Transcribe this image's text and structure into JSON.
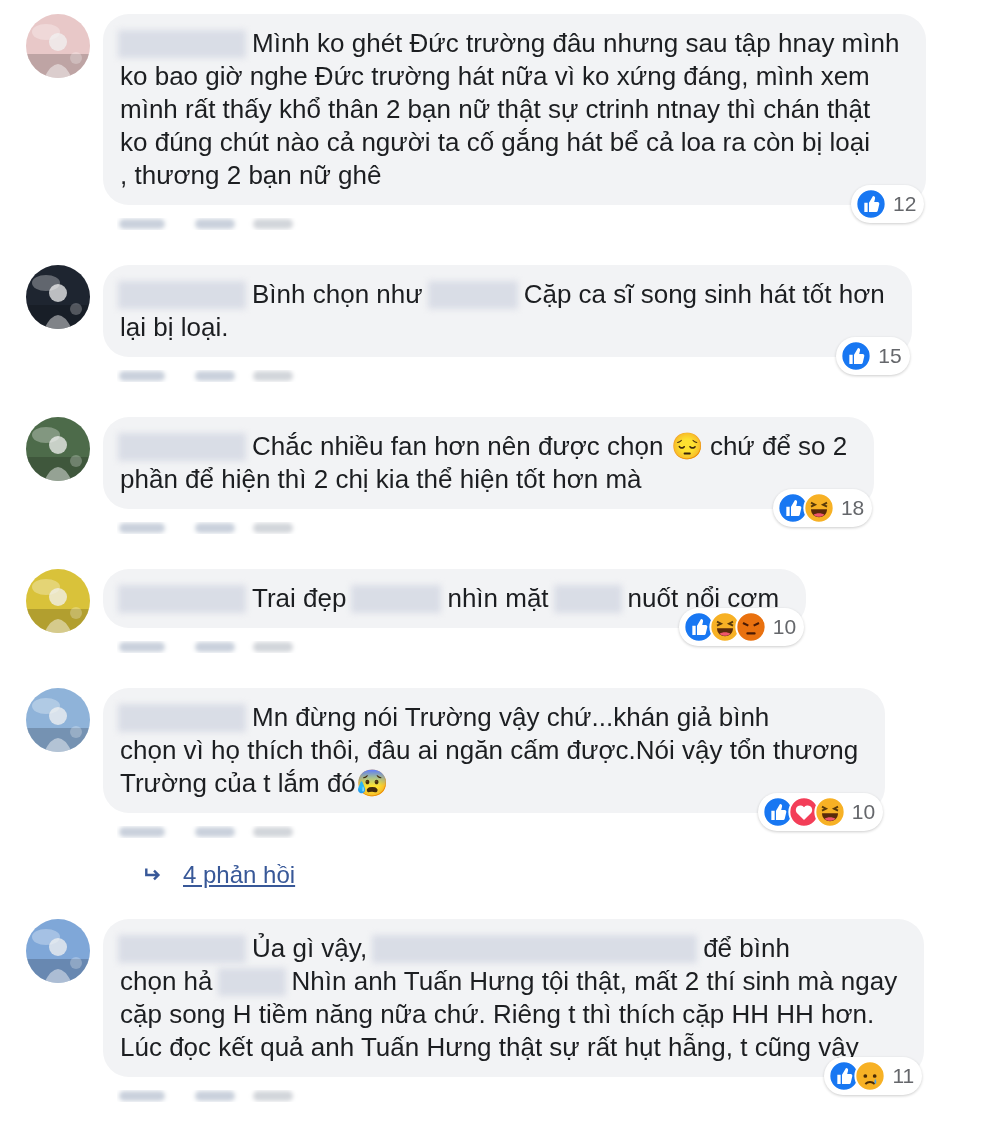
{
  "comments": [
    {
      "avatar": {
        "kind": "picture",
        "color": "#e8c8c8"
      },
      "lines": [
        [
          {
            "kind": "name"
          },
          {
            "kind": "text",
            "text": "Mình ko ghét Đức trường đâu nhưng sau tập hnay mình"
          }
        ],
        [
          {
            "kind": "text",
            "text": "ko bao giờ nghe Đức trường hát nữa vì ko xứng đáng, mình xem"
          }
        ],
        [
          {
            "kind": "text",
            "text": "mình rất thấy khổ thân 2 bạn nữ thật sự ctrinh ntnay thì chán thật"
          }
        ],
        [
          {
            "kind": "text",
            "text": "ko đúng chút nào cả người ta cố gắng hát bể cả loa ra còn bị loại"
          }
        ],
        [
          {
            "kind": "text",
            "text": ", thương 2 bạn nữ ghê"
          }
        ]
      ],
      "reactions": [
        {
          "kind": "like"
        }
      ],
      "count": "12"
    },
    {
      "avatar": {
        "kind": "picture",
        "color": "#1e2530"
      },
      "lines": [
        [
          {
            "kind": "name"
          },
          {
            "kind": "text",
            "text": "Bình chọn như"
          },
          {
            "kind": "blur"
          },
          {
            "kind": "text",
            "text": "Cặp ca sĩ song sinh hát tốt hơn"
          }
        ],
        [
          {
            "kind": "text",
            "text": "lại bị loại."
          }
        ]
      ],
      "reactions": [
        {
          "kind": "like"
        }
      ],
      "count": "15"
    },
    {
      "avatar": {
        "kind": "picture",
        "color": "#4d6b4a"
      },
      "lines": [
        [
          {
            "kind": "name"
          },
          {
            "kind": "text",
            "text": "Chắc nhiều fan hơn nên được chọn 😔 chứ để so 2"
          }
        ],
        [
          {
            "kind": "text",
            "text": "phần để hiện thì 2 chị kia thể hiện tốt hơn mà"
          }
        ]
      ],
      "reactions": [
        {
          "kind": "like"
        },
        {
          "kind": "haha"
        }
      ],
      "count": "18"
    },
    {
      "avatar": {
        "kind": "picture",
        "color": "#d9c23a"
      },
      "lines": [
        [
          {
            "kind": "name"
          },
          {
            "kind": "text",
            "text": "Trai đẹp"
          },
          {
            "kind": "blur"
          },
          {
            "kind": "text",
            "text": "nhìn mặt"
          },
          {
            "kind": "shortblur"
          },
          {
            "kind": "text",
            "text": "nuốt nổi cơm"
          }
        ]
      ],
      "reactions": [
        {
          "kind": "like"
        },
        {
          "kind": "haha"
        },
        {
          "kind": "angry"
        }
      ],
      "count": "10"
    },
    {
      "avatar": {
        "kind": "picture",
        "color": "#8fb3d9"
      },
      "lines": [
        [
          {
            "kind": "name"
          },
          {
            "kind": "text",
            "text": "Mn đừng nói Trường vậy chứ...khán giả bình"
          }
        ],
        [
          {
            "kind": "text",
            "text": "chọn vì họ thích thôi, đâu ai ngăn cấm được.Nói vậy tổn thương"
          }
        ],
        [
          {
            "kind": "text",
            "text": "Trường của t lắm đó😰"
          }
        ]
      ],
      "reactions": [
        {
          "kind": "like"
        },
        {
          "kind": "love"
        },
        {
          "kind": "haha"
        }
      ],
      "count": "10",
      "replies": "4 phản hồi"
    },
    {
      "avatar": {
        "kind": "picture",
        "color": "#7fa7d8"
      },
      "lines": [
        [
          {
            "kind": "name"
          },
          {
            "kind": "text",
            "text": "Ủa gì vậy,"
          },
          {
            "kind": "longblur"
          },
          {
            "kind": "text",
            "text": "để bình"
          }
        ],
        [
          {
            "kind": "text",
            "text": "chọn hả"
          },
          {
            "kind": "shortblur"
          },
          {
            "kind": "text",
            "text": "Nhìn anh Tuấn Hưng tội thật, mất 2 thí sinh mà ngay"
          }
        ],
        [
          {
            "kind": "text",
            "text": "cặp song H tiềm năng nữa chứ. Riêng t thì thích cặp HH HH hơn."
          }
        ],
        [
          {
            "kind": "text",
            "text": "Lúc đọc kết quả anh Tuấn Hưng thật sự rất hụt hẫng, t cũng vậy"
          }
        ]
      ],
      "reactions": [
        {
          "kind": "like"
        },
        {
          "kind": "sad"
        }
      ],
      "count": "11"
    }
  ]
}
